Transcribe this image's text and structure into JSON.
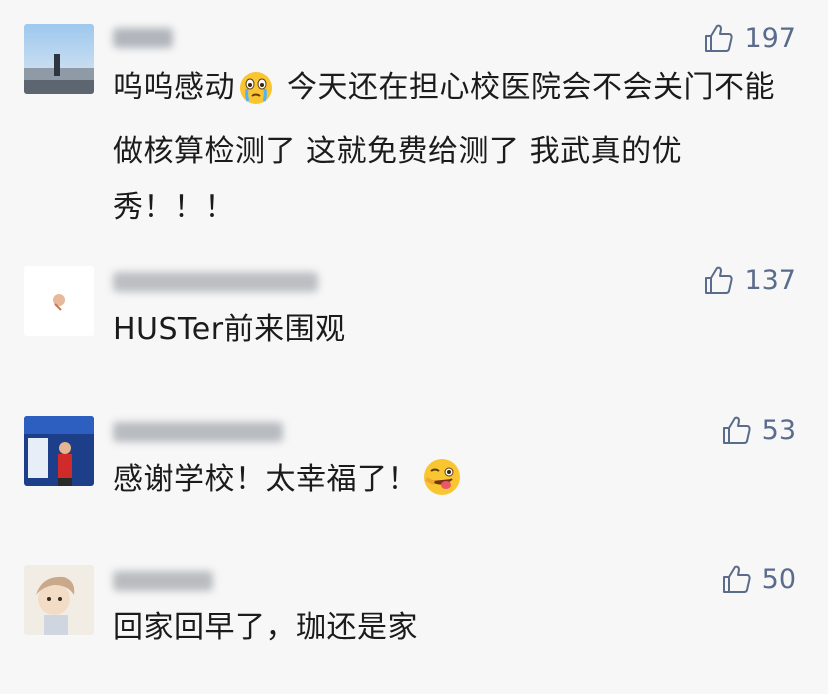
{
  "comments": [
    {
      "likes": "197",
      "text_before": "呜呜感动",
      "emoji": "crying-face",
      "text_after": " 今天还在担心校医院会不会关门不能做核算检测了 这就免费给测了 我武真的优秀！！！"
    },
    {
      "likes": "137",
      "text_before": "HUSTer前来围观",
      "emoji": "",
      "text_after": ""
    },
    {
      "likes": "53",
      "text_before": "感谢学校！太幸福了！",
      "emoji": "wink-tongue-face",
      "text_after": ""
    },
    {
      "likes": "50",
      "text_before": "回家回早了，珈还是家",
      "emoji": "",
      "text_after": ""
    }
  ],
  "colors": {
    "background": "#f7f7f7",
    "like_color": "#5a6b8c",
    "text": "#1b1b1b"
  }
}
